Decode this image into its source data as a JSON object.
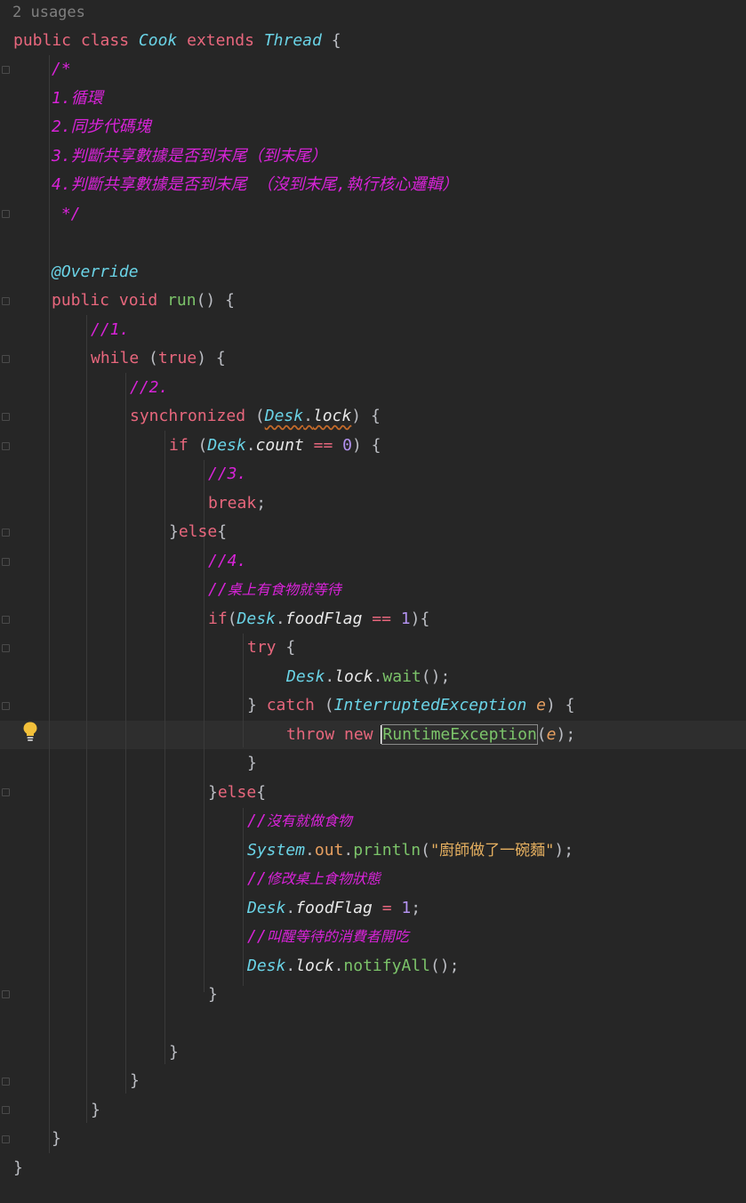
{
  "usages": "2 usages",
  "code": {
    "l01": {
      "kw1": "public",
      "kw2": "class",
      "cls": "Cook",
      "kw3": "extends",
      "base": "Thread",
      "brace": "{"
    },
    "l02": "/*",
    "l03": "1.循環",
    "l04": "2.同步代碼塊",
    "l05": "3.判斷共享數據是否到末尾（到末尾）",
    "l06": "4.判斷共享數據是否到末尾 （沒到末尾,執行核心邏輯）",
    "l07": " */",
    "l08": "@Override",
    "l09": {
      "kw1": "public",
      "kw2": "void",
      "fn": "run",
      "rest": "() {"
    },
    "l10": "//1.",
    "l11": {
      "kw": "while",
      "p1": " (",
      "kw2": "true",
      "p2": ") {"
    },
    "l12": "//2.",
    "l13": {
      "kw": "synchronized",
      "p1": " (",
      "cls": "Desk",
      "dot": ".",
      "fld": "lock",
      "p2": ") {"
    },
    "l14": {
      "kw": "if",
      "p1": " (",
      "cls": "Desk",
      "dot": ".",
      "fld": "count",
      "op": " == ",
      "num": "0",
      "p2": ") {"
    },
    "l15": "//3.",
    "l16": {
      "kw": "break",
      "p": ";"
    },
    "l17": {
      "b": "}",
      "kw": "else",
      "p": "{"
    },
    "l18": "//4.",
    "l19": {
      "slashes": "//",
      "text": "桌上有食物就等待"
    },
    "l20": {
      "kw": "if",
      "p1": "(",
      "cls": "Desk",
      "dot": ".",
      "fld": "foodFlag",
      "op": " == ",
      "num": "1",
      "p2": "){"
    },
    "l21": {
      "kw": "try",
      "p": " {"
    },
    "l22": {
      "cls": "Desk",
      "dot": ".",
      "fld": "lock",
      "dot2": ".",
      "fn": "wait",
      "p": "();"
    },
    "l23": {
      "b": "} ",
      "kw": "catch",
      "p1": " (",
      "cls": "InterruptedException",
      "sp": " ",
      "var": "e",
      "p2": ") {"
    },
    "l24": {
      "kw1": "throw",
      "kw2": "new",
      "first": "R",
      "fn": "untimeException",
      "p1": "(",
      "var": "e",
      "p2": ");"
    },
    "l25": "}",
    "l26": {
      "b": "}",
      "kw": "else",
      "p": "{"
    },
    "l27": {
      "slashes": "//",
      "text": "沒有就做食物"
    },
    "l28": {
      "cls": "System",
      "dot": ".",
      "fld": "out",
      "dot2": ".",
      "fn": "println",
      "p1": "(",
      "str": "\"廚師做了一碗麵\"",
      "p2": ");"
    },
    "l29": {
      "slashes": "//",
      "text": "修改桌上食物狀態"
    },
    "l30": {
      "cls": "Desk",
      "dot": ".",
      "fld": "foodFlag",
      "op": " = ",
      "num": "1",
      "p": ";"
    },
    "l31": {
      "slashes": "//",
      "text": "叫醒等待的消費者開吃"
    },
    "l32": {
      "cls": "Desk",
      "dot": ".",
      "fld": "lock",
      "dot2": ".",
      "fn": "notifyAll",
      "p": "();"
    },
    "l33": "}",
    "l35": "}",
    "l36": "}",
    "l37": "}",
    "l38": "}",
    "l39": "}"
  },
  "colors": {
    "background": "#262626",
    "keyword": "#e8677d",
    "comment": "#d923d9",
    "class": "#6ad3e6",
    "method": "#7cc46a",
    "number": "#b392f0",
    "string": "#e6b060"
  },
  "icons": {
    "intention": "lightbulb-icon",
    "fold": "fold-marker-icon"
  }
}
